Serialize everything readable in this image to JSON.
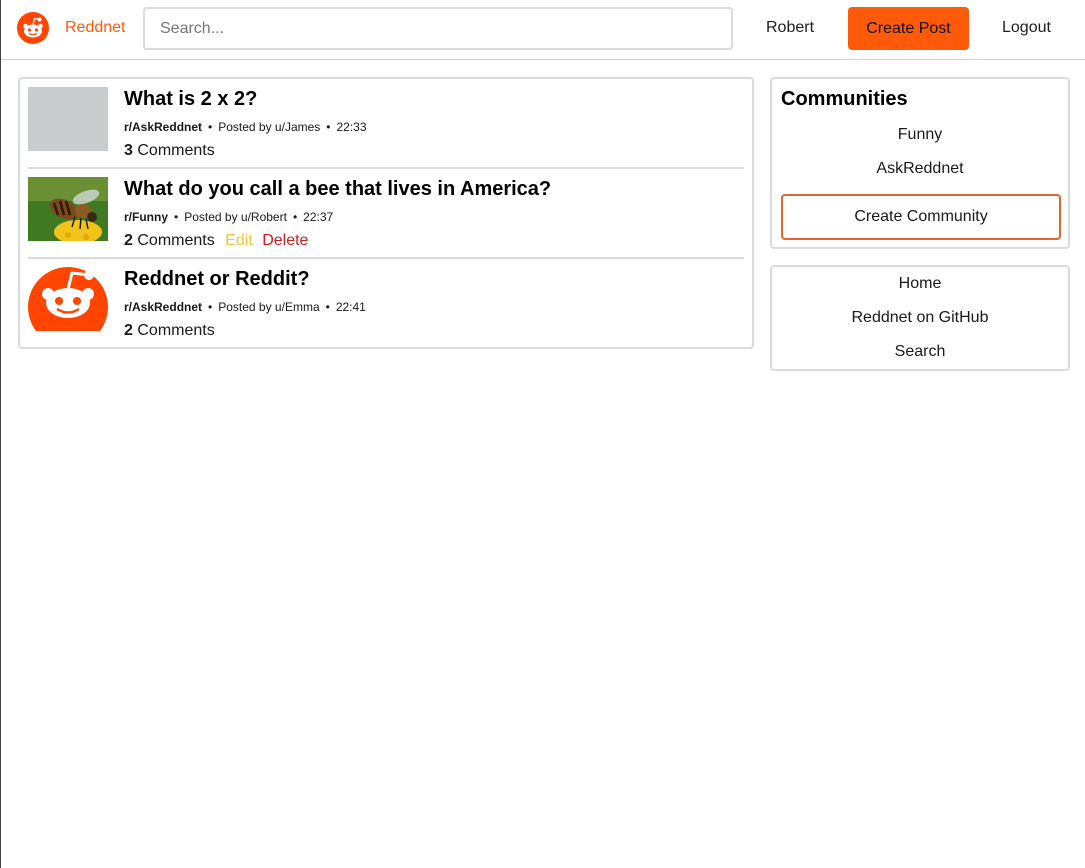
{
  "header": {
    "brand": "Reddnet",
    "search_placeholder": "Search...",
    "username": "Robert",
    "create_post_label": "Create Post",
    "logout_label": "Logout"
  },
  "colors": {
    "accent": "#ff5a0a",
    "edit": "#f5c33b",
    "delete": "#cc2020"
  },
  "posts": [
    {
      "title": "What is 2 x 2?",
      "community": "r/AskReddnet",
      "posted_by": "Posted by u/James",
      "time": "22:33",
      "comment_count": "3",
      "comments_label": "Comments",
      "thumbnail": "placeholder"
    },
    {
      "title": "What do you call a bee that lives in America?",
      "community": "r/Funny",
      "posted_by": "Posted by u/Robert",
      "time": "22:37",
      "comment_count": "2",
      "comments_label": "Comments",
      "edit_label": "Edit",
      "delete_label": "Delete",
      "thumbnail": "bee-photo"
    },
    {
      "title": "Reddnet or Reddit?",
      "community": "r/AskReddnet",
      "posted_by": "Posted by u/Emma",
      "time": "22:41",
      "comment_count": "2",
      "comments_label": "Comments",
      "thumbnail": "reddit-logo"
    }
  ],
  "sidebar": {
    "communities_title": "Communities",
    "communities": [
      "Funny",
      "AskReddnet"
    ],
    "create_community_label": "Create Community",
    "links": [
      "Home",
      "Reddnet on GitHub",
      "Search"
    ]
  }
}
